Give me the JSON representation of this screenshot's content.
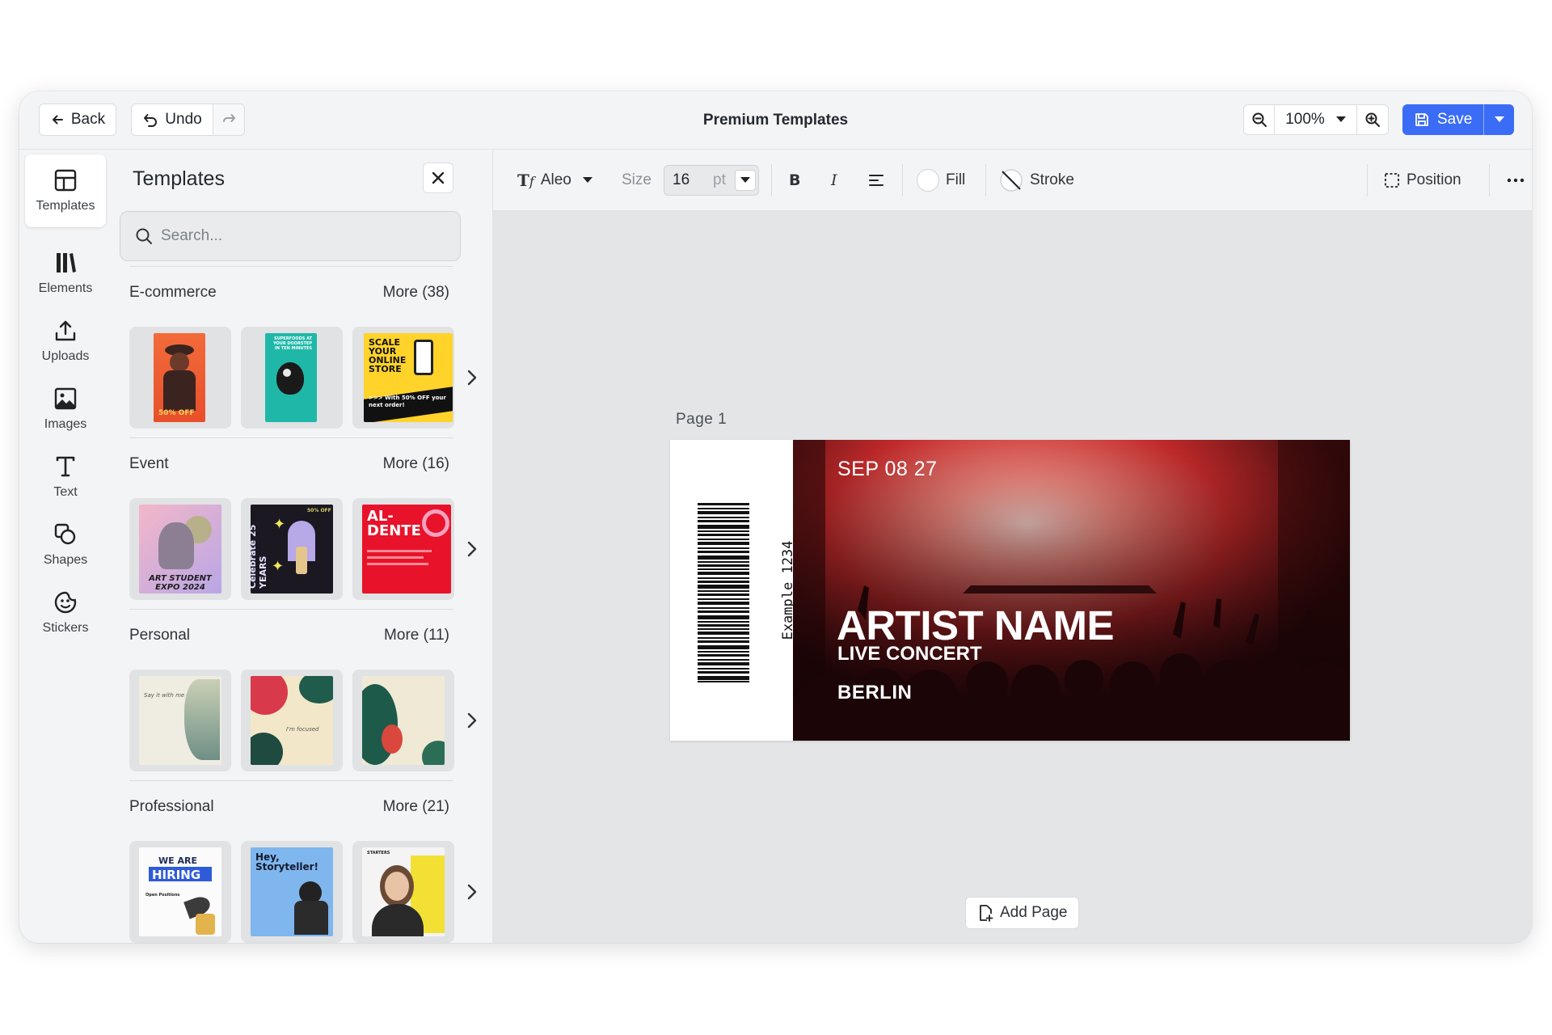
{
  "topbar": {
    "back_label": "Back",
    "undo_label": "Undo",
    "title": "Premium Templates",
    "zoom_value": "100%",
    "save_label": "Save",
    "brand_color": "#3b6cf6"
  },
  "rail": {
    "items": [
      {
        "label": "Templates",
        "icon": "layout-icon",
        "active": true
      },
      {
        "label": "Elements",
        "icon": "library-icon"
      },
      {
        "label": "Uploads",
        "icon": "upload-icon"
      },
      {
        "label": "Images",
        "icon": "image-icon"
      },
      {
        "label": "Text",
        "icon": "text-icon"
      },
      {
        "label": "Shapes",
        "icon": "shapes-icon"
      },
      {
        "label": "Stickers",
        "icon": "sticker-icon"
      }
    ]
  },
  "panel": {
    "title": "Templates",
    "search_placeholder": "Search...",
    "categories": [
      {
        "name": "E-commerce",
        "more": "More (38)"
      },
      {
        "name": "Event",
        "more": "More (16)"
      },
      {
        "name": "Personal",
        "more": "More (11)"
      },
      {
        "name": "Professional",
        "more": "More (21)"
      }
    ],
    "thumb_text": {
      "ecom_1": "50% OFF",
      "ecom_2": "SUPERFOODS AT YOUR DOORSTEP IN TEN MINUTES",
      "ecom_3_title": "SCALE YOUR ONLINE STORE",
      "ecom_3_sub": ">>> With 50% OFF your next order!",
      "event_1": "ART STUDENT EXPO 2024",
      "event_2": "Celebrate 25 YEARS",
      "event_2_tag": "50% OFF",
      "event_3": "AL-DENTE",
      "personal_1": "Say it with me",
      "personal_2": "I'm focused",
      "prof_1_a": "WE ARE",
      "prof_1_b": "HIRING",
      "prof_1_c": "Open Positions",
      "prof_2": "Hey, Storyteller!",
      "prof_3": "STARTERS"
    }
  },
  "format_toolbar": {
    "font_name": "Aleo",
    "size_label": "Size",
    "size_value": "16",
    "size_unit": "pt",
    "bold": "B",
    "italic": "I",
    "fill_label": "Fill",
    "stroke_label": "Stroke",
    "position_label": "Position"
  },
  "canvas": {
    "page_label": "Page  1",
    "add_page_label": "Add Page",
    "ticket": {
      "stub_text": "Example 1234",
      "date": "SEP 08 27",
      "artist": "ARTIST NAME",
      "subtitle": "LIVE CONCERT",
      "city": "BERLIN"
    }
  }
}
